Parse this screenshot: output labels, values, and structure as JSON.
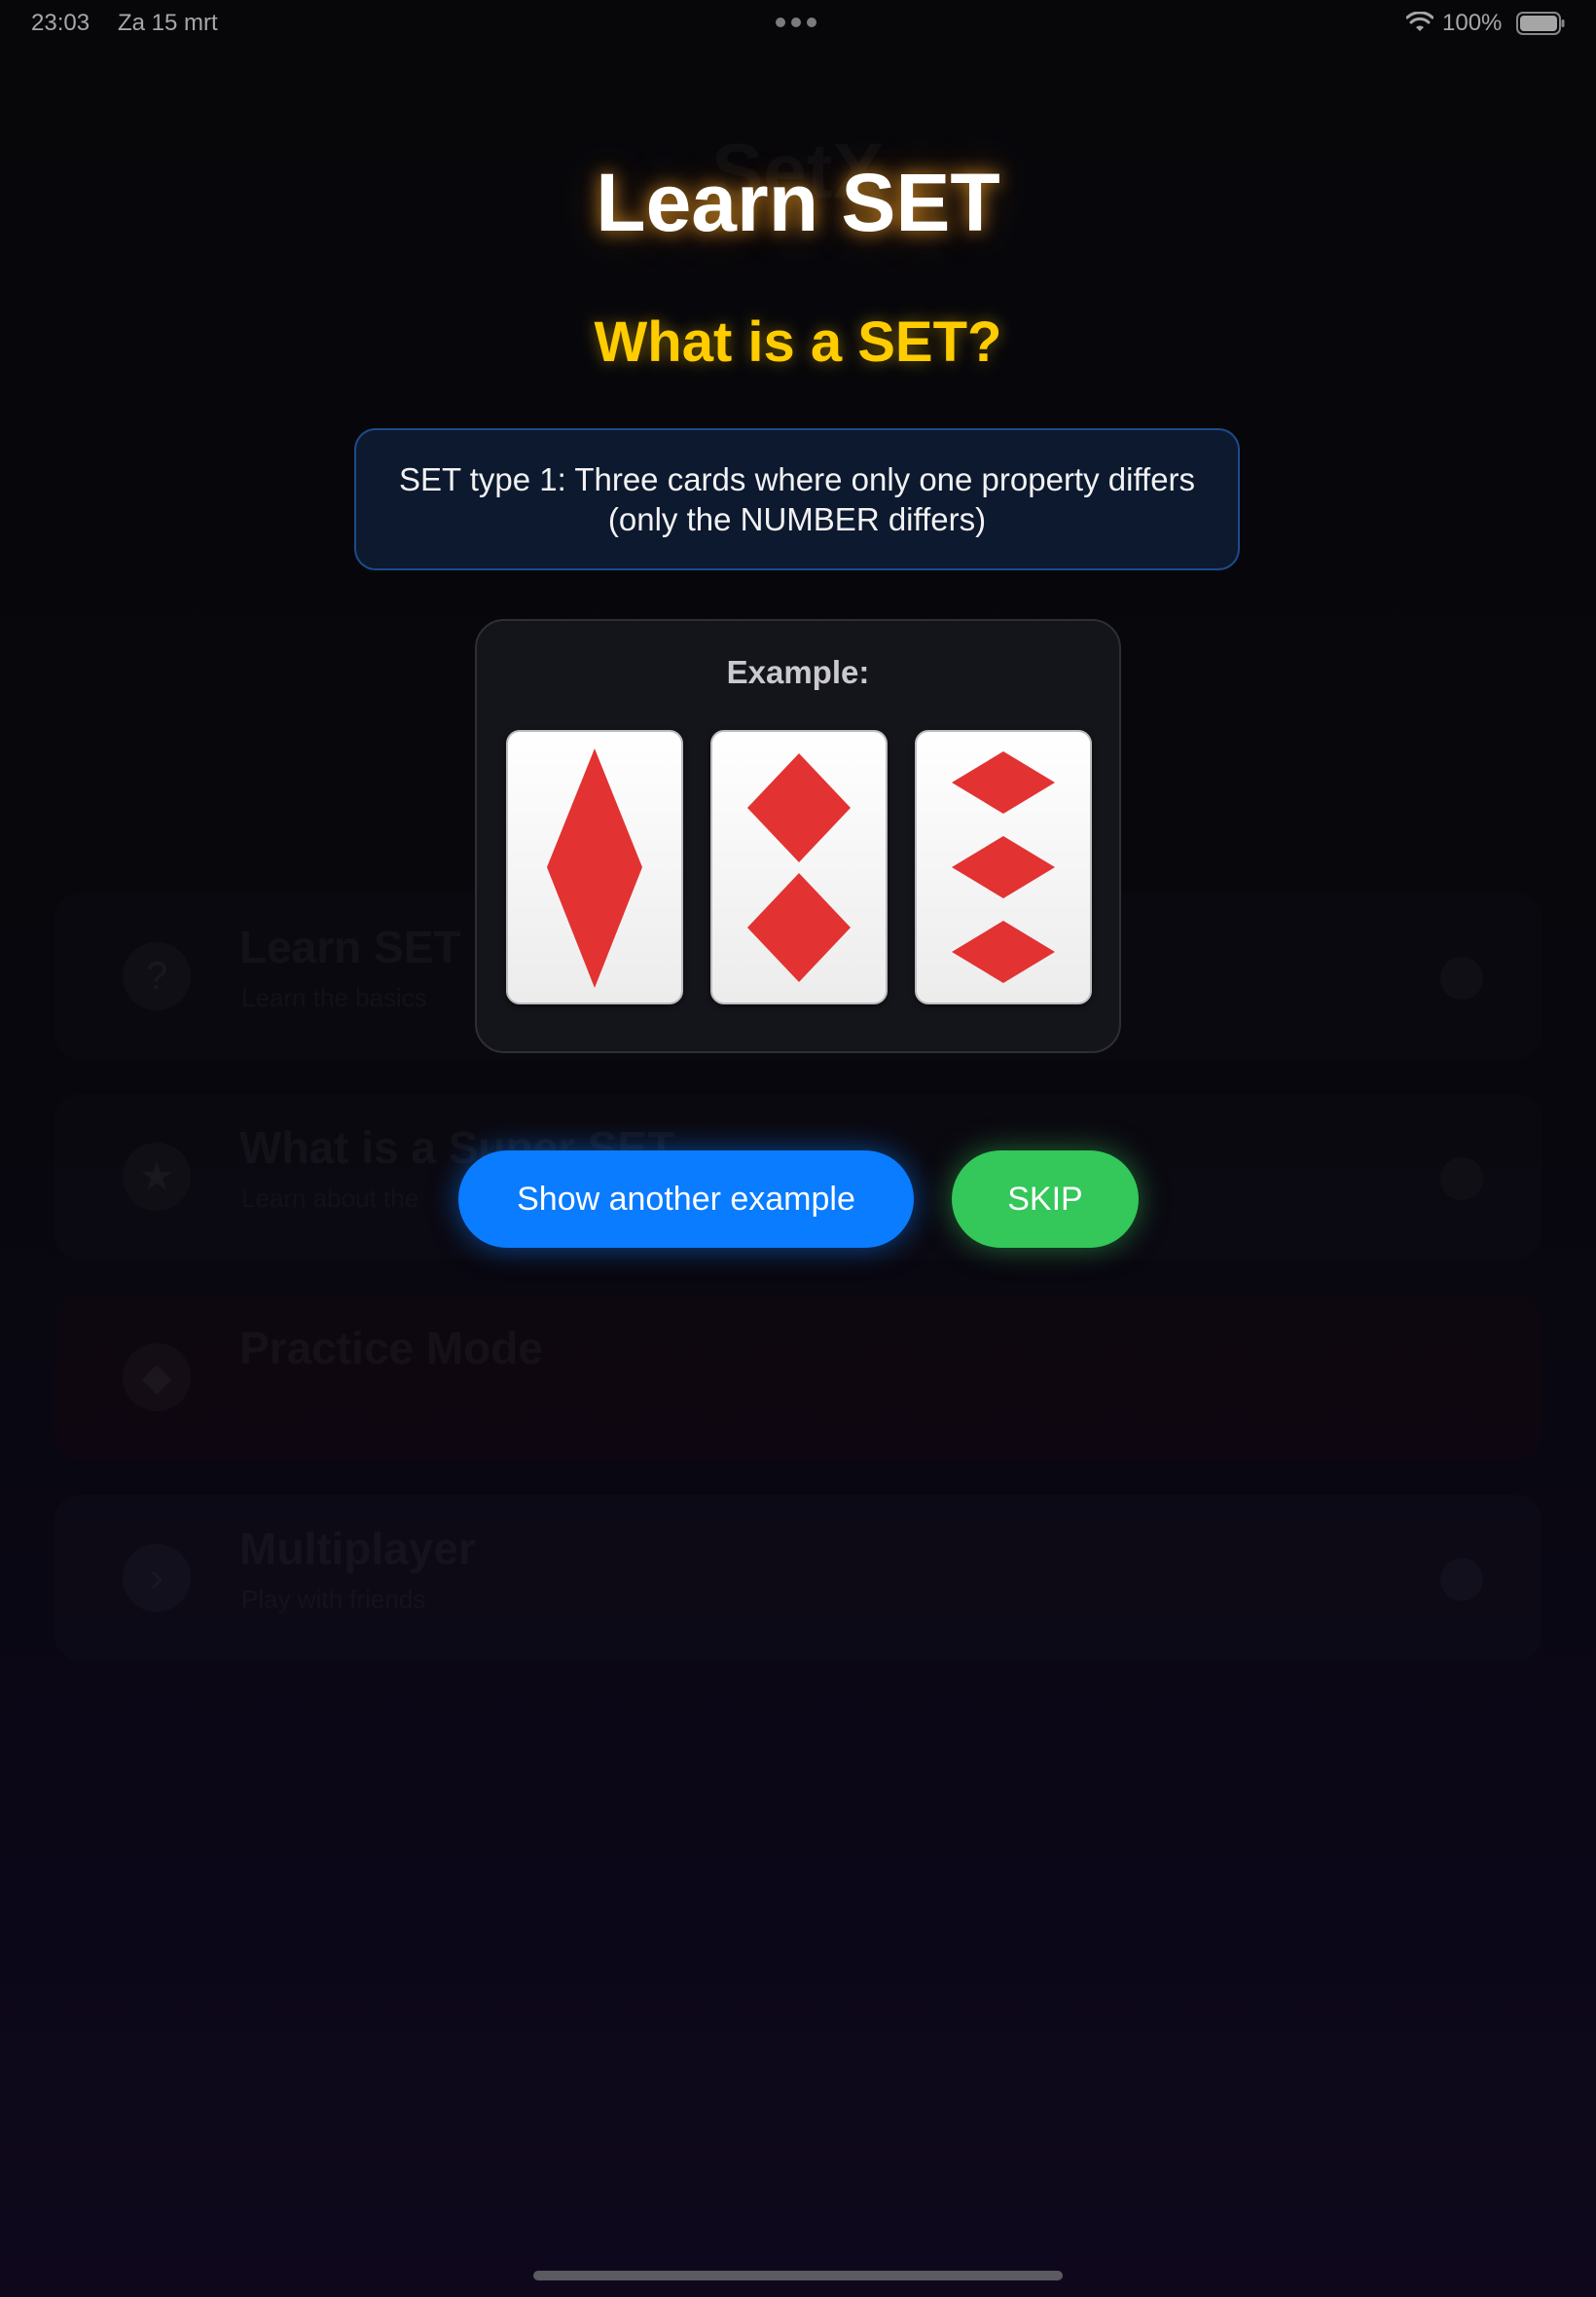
{
  "status_bar": {
    "time": "23:03",
    "date": "Za 15 mrt",
    "battery_percent": "100%",
    "icons": [
      "more-dots-icon",
      "wifi-icon",
      "battery-icon"
    ]
  },
  "background_menu": {
    "app_title": "SetX",
    "items": [
      {
        "title": "Learn SET",
        "subtitle": "Learn the basics",
        "icon": "question-icon"
      },
      {
        "title": "What is a Super SET",
        "subtitle": "Learn about the",
        "icon": "star-icon"
      },
      {
        "title": "Practice Mode",
        "subtitle": "",
        "icon": "graduation-cap-icon"
      },
      {
        "title": "Multiplayer",
        "subtitle": "Play with friends",
        "icon": "arrow-icon"
      }
    ]
  },
  "tutorial": {
    "title": "Learn SET",
    "heading": "What is a SET?",
    "description_line1": "SET type 1: Three cards where only one property differs",
    "description_line2": "(only the NUMBER differs)",
    "example_label": "Example:",
    "cards": [
      {
        "count": 1,
        "shape": "diamond",
        "color": "#e33232",
        "shading": "solid"
      },
      {
        "count": 2,
        "shape": "diamond",
        "color": "#e33232",
        "shading": "solid"
      },
      {
        "count": 3,
        "shape": "diamond",
        "color": "#e33232",
        "shading": "solid"
      }
    ],
    "buttons": {
      "another_example": "Show another example",
      "skip": "SKIP"
    },
    "colors": {
      "title_glow": "#ffaa28",
      "heading": "#ffcc00",
      "primary_button": "#0a7cff",
      "skip_button": "#34c759",
      "card_shape": "#e33232"
    }
  }
}
